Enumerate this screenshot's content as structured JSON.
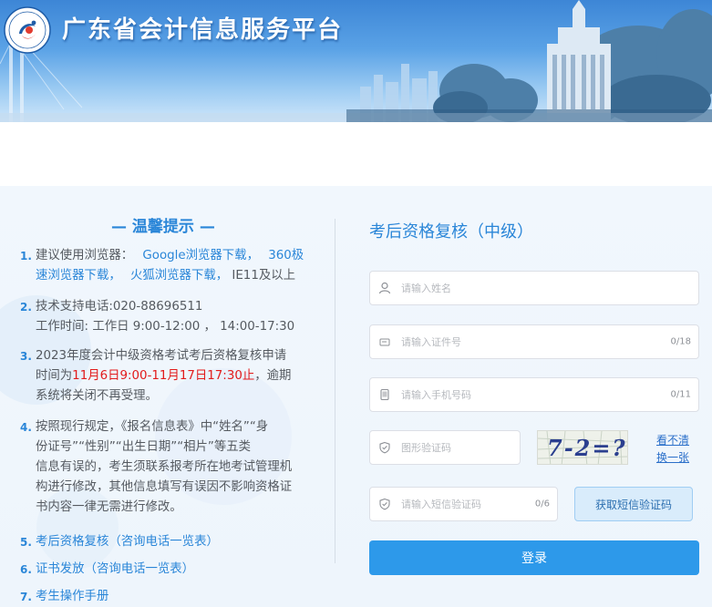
{
  "header": {
    "site_title": "广东省会计信息服务平台",
    "colors": {
      "sky_top": "#3d86d6",
      "sky_bottom": "#cfe6fa"
    }
  },
  "tips": {
    "title": "— 温馨提示 —",
    "items": [
      {
        "num": "1.",
        "prefix": "建议使用浏览器：",
        "google_link": "Google浏览器下载，",
        "link360_a": "360极",
        "link360_b": "速浏览器下载，",
        "firefox_link": "火狐浏览器下载，",
        "suffix": "IE11及以上"
      },
      {
        "num": "2.",
        "line1": "技术支持电话:020-88696511",
        "line2": "工作时间: 工作日 9:00-12:00 ， 14:00-17:30"
      },
      {
        "num": "3.",
        "line1": "2023年度会计中级资格考试考后资格复核申请",
        "line2_prefix": "时间为",
        "line2_red": "11月6日9:00-11月17日17:30止",
        "line2_suffix": "，逾期",
        "line3": "系统将关闭不再受理。"
      },
      {
        "num": "4.",
        "line1": "按照现行规定，《报名信息表》中“姓名”“身",
        "line2": "份证号”“性别”“出生日期”“相片”等五类",
        "line3": "信息有误的，考生须联系报考所在地考试管理机",
        "line4": "构进行修改，其他信息填写有误因不影响资格证",
        "line5": "书内容一律无需进行修改。"
      },
      {
        "num": "5.",
        "link": "考后资格复核（咨询电话一览表）"
      },
      {
        "num": "6.",
        "link": "证书发放（咨询电话一览表）"
      },
      {
        "num": "7.",
        "link": "考生操作手册"
      }
    ]
  },
  "form": {
    "title": "考后资格复核（中级）",
    "name_placeholder": "请输入姓名",
    "id_placeholder": "请输入证件号",
    "id_count": "0/18",
    "phone_placeholder": "请输入手机号码",
    "phone_count": "0/11",
    "captcha_placeholder": "图形验证码",
    "captcha_text": "7-2=?",
    "captcha_link_1": "看不清",
    "captcha_link_2": "换一张",
    "sms_placeholder": "请输入短信验证码",
    "sms_count": "0/6",
    "sms_button": "获取短信验证码",
    "login_button": "登录",
    "colors": {
      "accent": "#2a86d8",
      "login_bg": "#2d99ea",
      "alert_red": "#e21b1b"
    }
  }
}
